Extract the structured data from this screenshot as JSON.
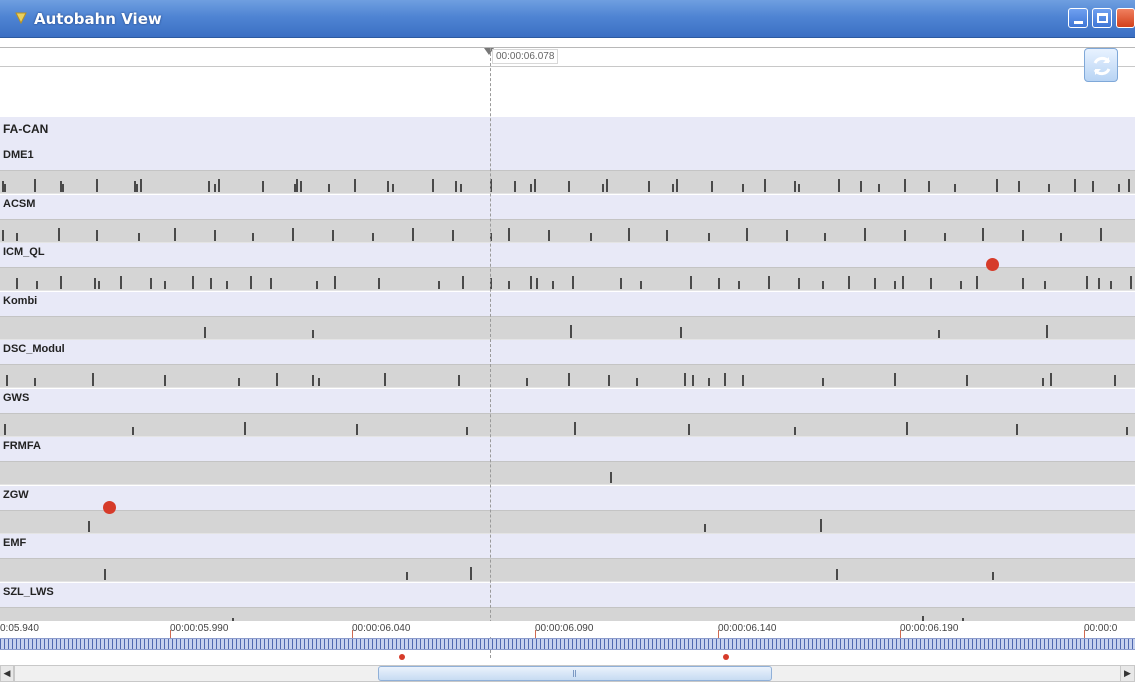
{
  "window": {
    "title": "Autobahn View"
  },
  "cursor": {
    "time": "00:00:06.078"
  },
  "group": {
    "label": "FA-CAN"
  },
  "channels": [
    {
      "label": "DME1"
    },
    {
      "label": "ACSM"
    },
    {
      "label": "ICM_QL"
    },
    {
      "label": "Kombi"
    },
    {
      "label": "DSC_Modul"
    },
    {
      "label": "GWS"
    },
    {
      "label": "FRMFA"
    },
    {
      "label": "ZGW"
    },
    {
      "label": "EMF"
    },
    {
      "label": "SZL_LWS"
    }
  ],
  "time_axis": {
    "ticks": [
      "0:05.940",
      "00:00:05.990",
      "00:00:06.040",
      "00:00:06.090",
      "00:00:06.140",
      "00:00:06.190",
      "00:00:0"
    ]
  },
  "icons": {
    "title_icon": "app-icon",
    "refresh": "refresh-icon",
    "scroll_left": "arrow-left-icon",
    "scroll_right": "arrow-right-icon"
  },
  "colors": {
    "titlebar": "#4f84d3",
    "channel_header_bg": "#e8e9f7",
    "track_bg": "#d5d5d5",
    "marker_red": "#d63b2a"
  }
}
